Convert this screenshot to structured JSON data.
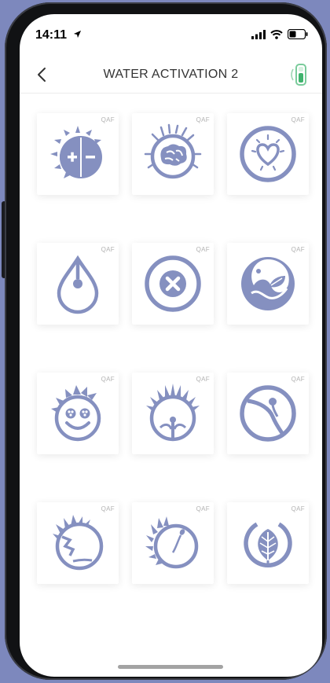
{
  "status_bar": {
    "time": "14:11"
  },
  "header": {
    "title": "WATER ACTIVATION 2"
  },
  "icon_color": "#8590c0",
  "tiles": [
    {
      "tag": "QAF",
      "icon": "sun-plus-minus-icon"
    },
    {
      "tag": "QAF",
      "icon": "brain-icon"
    },
    {
      "tag": "QAF",
      "icon": "heart-radiating-icon"
    },
    {
      "tag": "QAF",
      "icon": "water-drop-icon"
    },
    {
      "tag": "QAF",
      "icon": "x-circle-icon"
    },
    {
      "tag": "QAF",
      "icon": "yin-yang-leaf-icon"
    },
    {
      "tag": "QAF",
      "icon": "smiling-face-icon"
    },
    {
      "tag": "QAF",
      "icon": "sprouting-head-icon"
    },
    {
      "tag": "QAF",
      "icon": "seed-circle-icon"
    },
    {
      "tag": "QAF",
      "icon": "cracked-face-icon"
    },
    {
      "tag": "QAF",
      "icon": "sperm-circle-icon"
    },
    {
      "tag": "QAF",
      "icon": "leaf-circle-icon"
    }
  ]
}
